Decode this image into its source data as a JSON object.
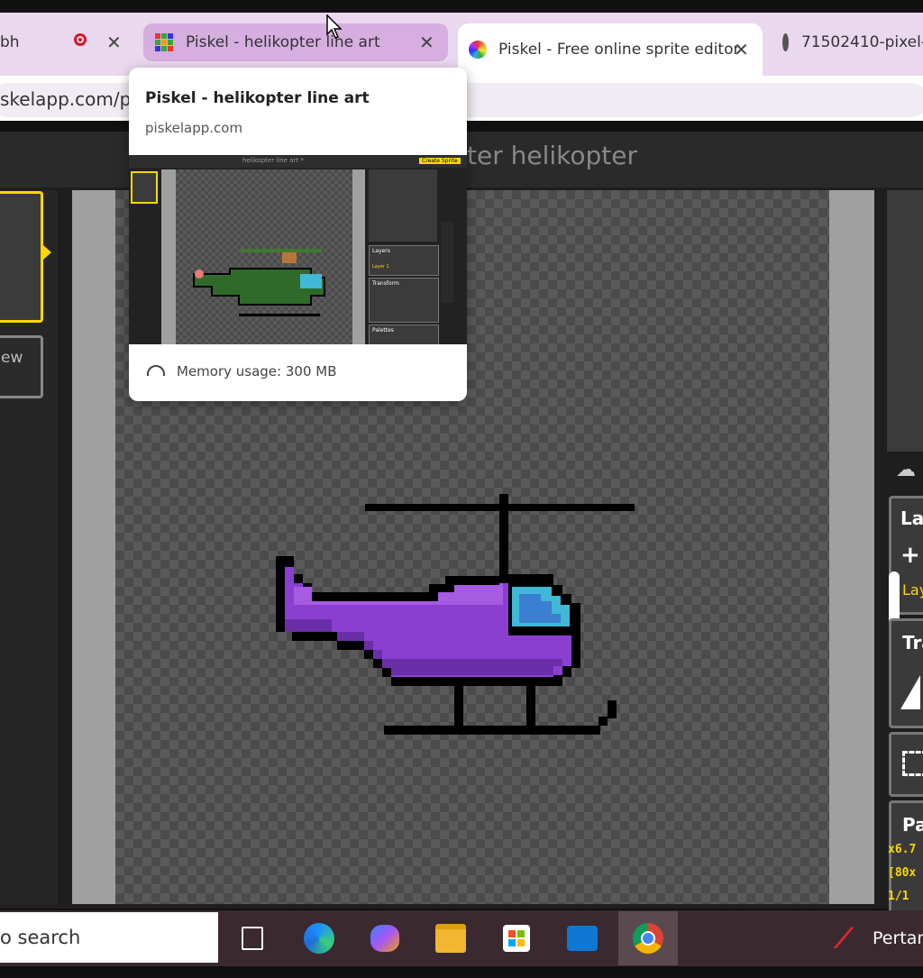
{
  "tabs": [
    {
      "label": "bh"
    },
    {
      "label": "Piskel - helikopter line art"
    },
    {
      "label": "Piskel - Free online sprite editor"
    },
    {
      "label": "71502410-pixel-"
    }
  ],
  "close_glyph": "✕",
  "address": {
    "url": "skelapp.com/p/c"
  },
  "popup": {
    "title": "Piskel - helikopter line art",
    "domain": "piskelapp.com",
    "memory": "Memory usage: 300 MB",
    "thumb_title": "helikopter line art *",
    "thumb_button": "Create Sprite",
    "thumb_layers": "Layers",
    "thumb_layer_item": "Layer 1",
    "thumb_transform": "Transform",
    "thumb_palettes": "Palettes"
  },
  "piskel": {
    "title": "ter helikopter",
    "new_frame_label": "ew",
    "panel_layers": "La",
    "panel_layer_item": "Lay",
    "panel_transform": "Tra",
    "panel_palettes": "Pa",
    "info1": "x6.7",
    "info2": "[80x",
    "info3": "1/1",
    "plus": "+"
  },
  "taskbar": {
    "search_text": "o search",
    "pinned_label": "Pertan"
  },
  "colors": {
    "accent": "#ffd700",
    "heli_body": "#8b3fd1",
    "heli_highlight": "#a55be2",
    "heli_shadow": "#6a2fa8",
    "window": "#40b8d6",
    "window_inner": "#3b7fd0"
  }
}
